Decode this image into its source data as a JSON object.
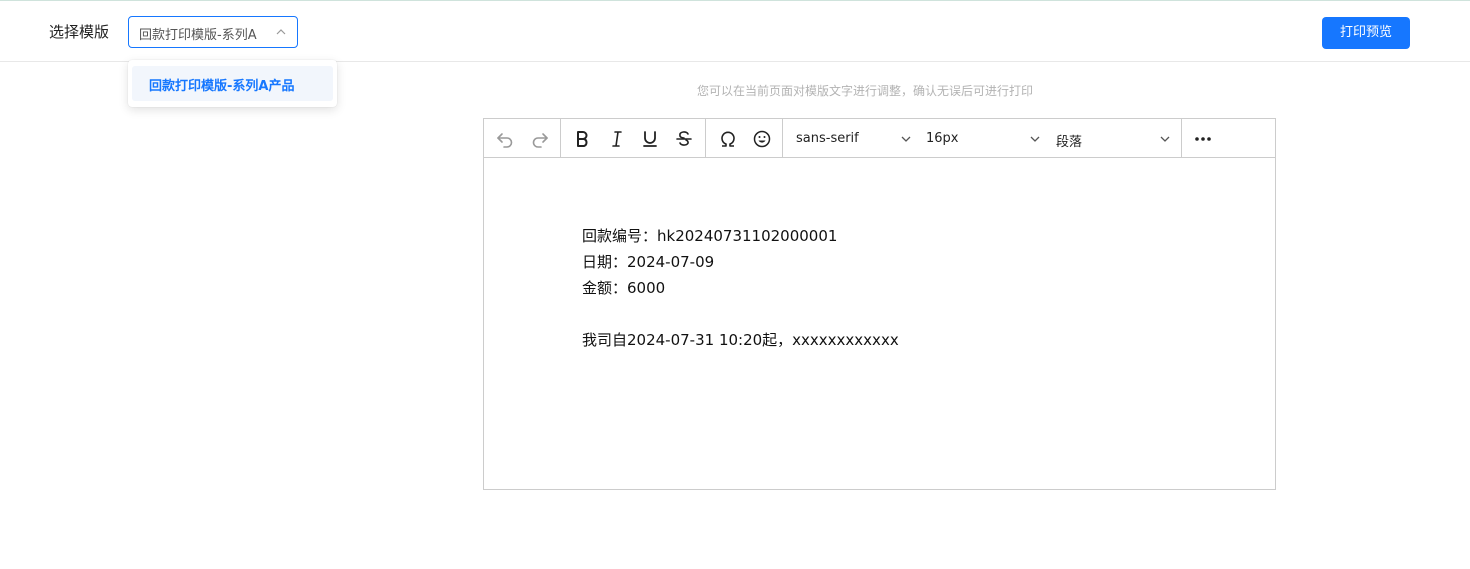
{
  "header": {
    "template_label": "选择模版",
    "selected_template": "回款打印模版-系列A",
    "print_button": "打印预览"
  },
  "dropdown": {
    "options": [
      "回款打印模版-系列A产品"
    ]
  },
  "hint": "您可以在当前页面对模版文字进行调整，确认无误后可进行打印",
  "toolbar": {
    "font_family": "sans-serif",
    "font_size": "16px",
    "block_type": "段落"
  },
  "content": {
    "lines": [
      "回款编号：hk20240731102000001",
      "日期：2024-07-09",
      "金额：6000",
      "我司自2024-07-31 10:20起，xxxxxxxxxxxx"
    ]
  },
  "colors": {
    "accent": "#1677ff",
    "hint_text": "#b3b3b3",
    "border": "#cccccc"
  }
}
